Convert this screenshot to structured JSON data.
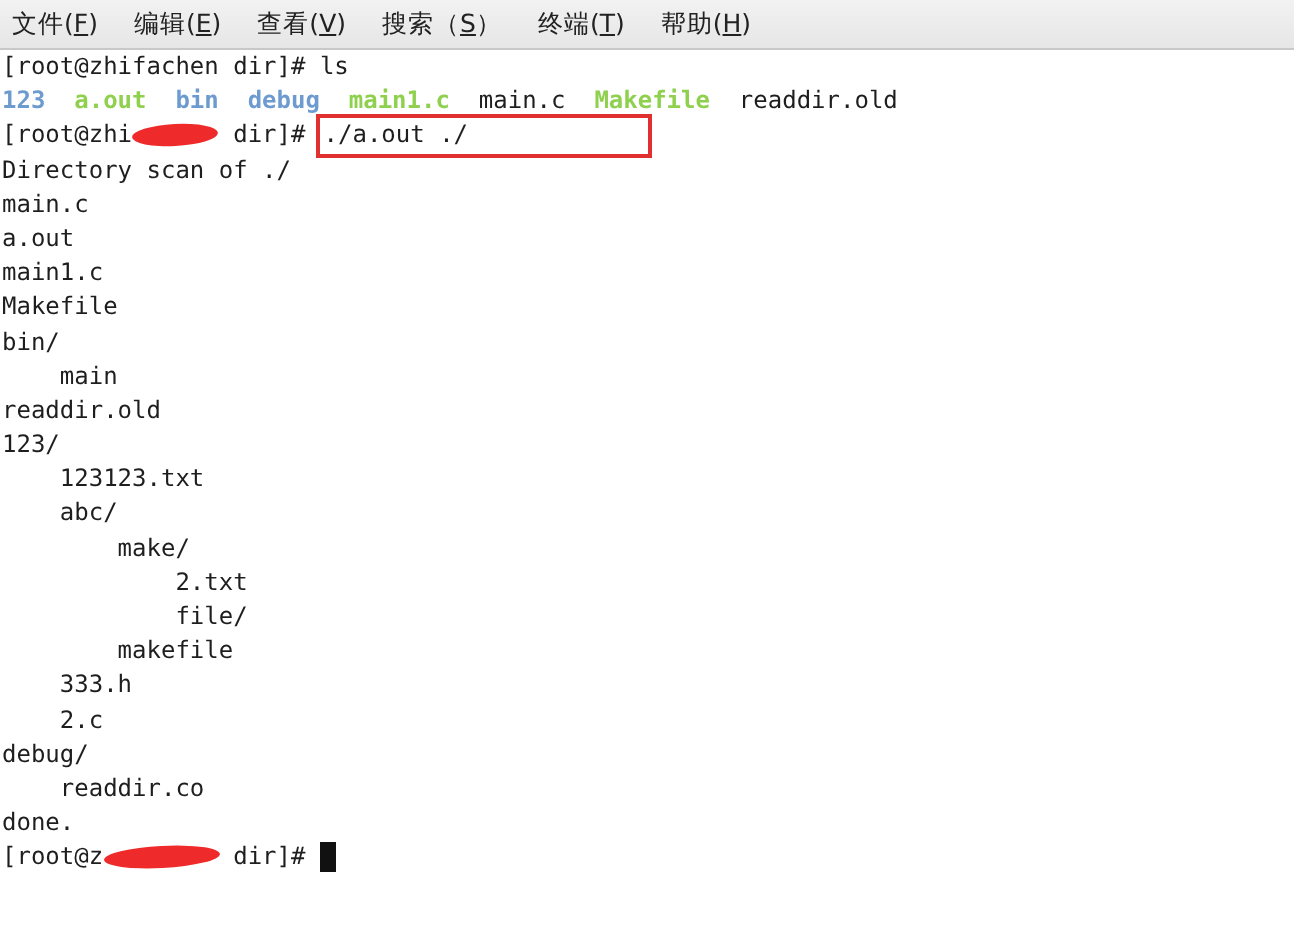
{
  "menu": [
    {
      "before": "文件(",
      "key": "F",
      "after": ")"
    },
    {
      "before": "编辑(",
      "key": "E",
      "after": ")"
    },
    {
      "before": "查看(",
      "key": "V",
      "after": ")"
    },
    {
      "before": "搜索（",
      "key": "S",
      "after": "）"
    },
    {
      "before": "终端(",
      "key": "T",
      "after": ")"
    },
    {
      "before": "帮助(",
      "key": "H",
      "after": ")"
    }
  ],
  "terminal": {
    "lines": [
      {
        "kind": "prompt",
        "prefix": "[root@zhifachen dir]#",
        "redacted": false,
        "command": "ls"
      },
      {
        "kind": "listing",
        "items": [
          {
            "name": "123",
            "color": "#6d9bcf"
          },
          {
            "name": "a.out",
            "color": "#8fd14f"
          },
          {
            "name": "bin",
            "color": "#6d9bcf"
          },
          {
            "name": "debug",
            "color": "#6d9bcf"
          },
          {
            "name": "main1.c",
            "color": "#8fd14f"
          },
          {
            "name": "main.c",
            "color": "#1e1e1e"
          },
          {
            "name": "Makefile",
            "color": "#8fd14f"
          },
          {
            "name": "readdir.old",
            "color": "#1e1e1e"
          }
        ]
      },
      {
        "kind": "prompt",
        "prefix": "[root@zhi",
        "redacted": true,
        "suffix": "dir]#",
        "command": "./a.out ./",
        "highlighted": true
      },
      {
        "kind": "text",
        "text": "Directory scan of ./"
      },
      {
        "kind": "tree",
        "entries": [
          {
            "name": "main.c"
          },
          {
            "name": "a.out"
          },
          {
            "name": "main1.c"
          },
          {
            "name": "Makefile"
          },
          {
            "name": "bin/",
            "children": [
              {
                "name": "main"
              }
            ]
          },
          {
            "name": "readdir.old"
          },
          {
            "name": "123/",
            "children": [
              {
                "name": "123123.txt"
              },
              {
                "name": "abc/",
                "children": [
                  {
                    "name": "make/",
                    "children": [
                      {
                        "name": "2.txt"
                      },
                      {
                        "name": "file/"
                      }
                    ]
                  },
                  {
                    "name": "makefile"
                  }
                ]
              },
              {
                "name": "333.h"
              },
              {
                "name": "2.c"
              }
            ]
          },
          {
            "name": "debug/",
            "children": [
              {
                "name": "readdir.co"
              }
            ]
          }
        ]
      },
      {
        "kind": "text",
        "text": "done."
      },
      {
        "kind": "prompt",
        "prefix": "[root@z",
        "redacted": true,
        "suffix": "dir]#",
        "cursor": true
      }
    ]
  }
}
